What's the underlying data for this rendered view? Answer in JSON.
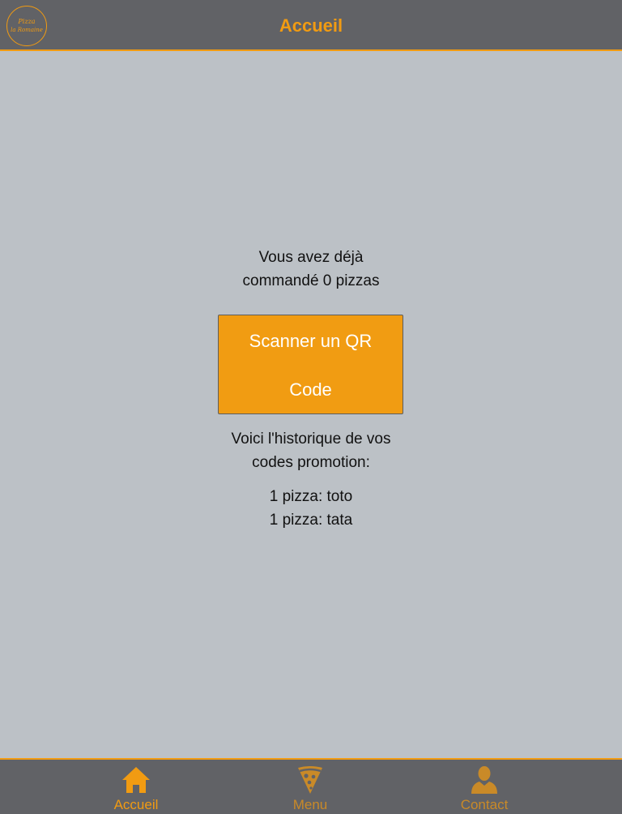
{
  "app": {
    "title": "Accueil",
    "logo": {
      "icon": "restaurant-logo",
      "text_line1": "Pizza",
      "text_line2": "la Romaine"
    }
  },
  "main": {
    "order_line1": "Vous avez déjà",
    "order_line2": "commandé 0 pizzas",
    "scan_button_line1": "Scanner un QR",
    "scan_button_line2": "Code",
    "history_line1": "Voici l'historique de vos",
    "history_line2": "codes promotion:",
    "promo_codes": [
      "1 pizza: toto",
      "1 pizza: tata"
    ]
  },
  "tabbar": {
    "tabs": [
      {
        "label": "Accueil",
        "icon": "home-icon",
        "active": true
      },
      {
        "label": "Menu",
        "icon": "pizza-slice-icon",
        "active": false
      },
      {
        "label": "Contact",
        "icon": "person-icon",
        "active": false
      }
    ]
  },
  "colors": {
    "accent": "#f19b12",
    "header_bg": "#616266",
    "content_bg": "#bcc1c6",
    "button_text": "#ffffff"
  }
}
